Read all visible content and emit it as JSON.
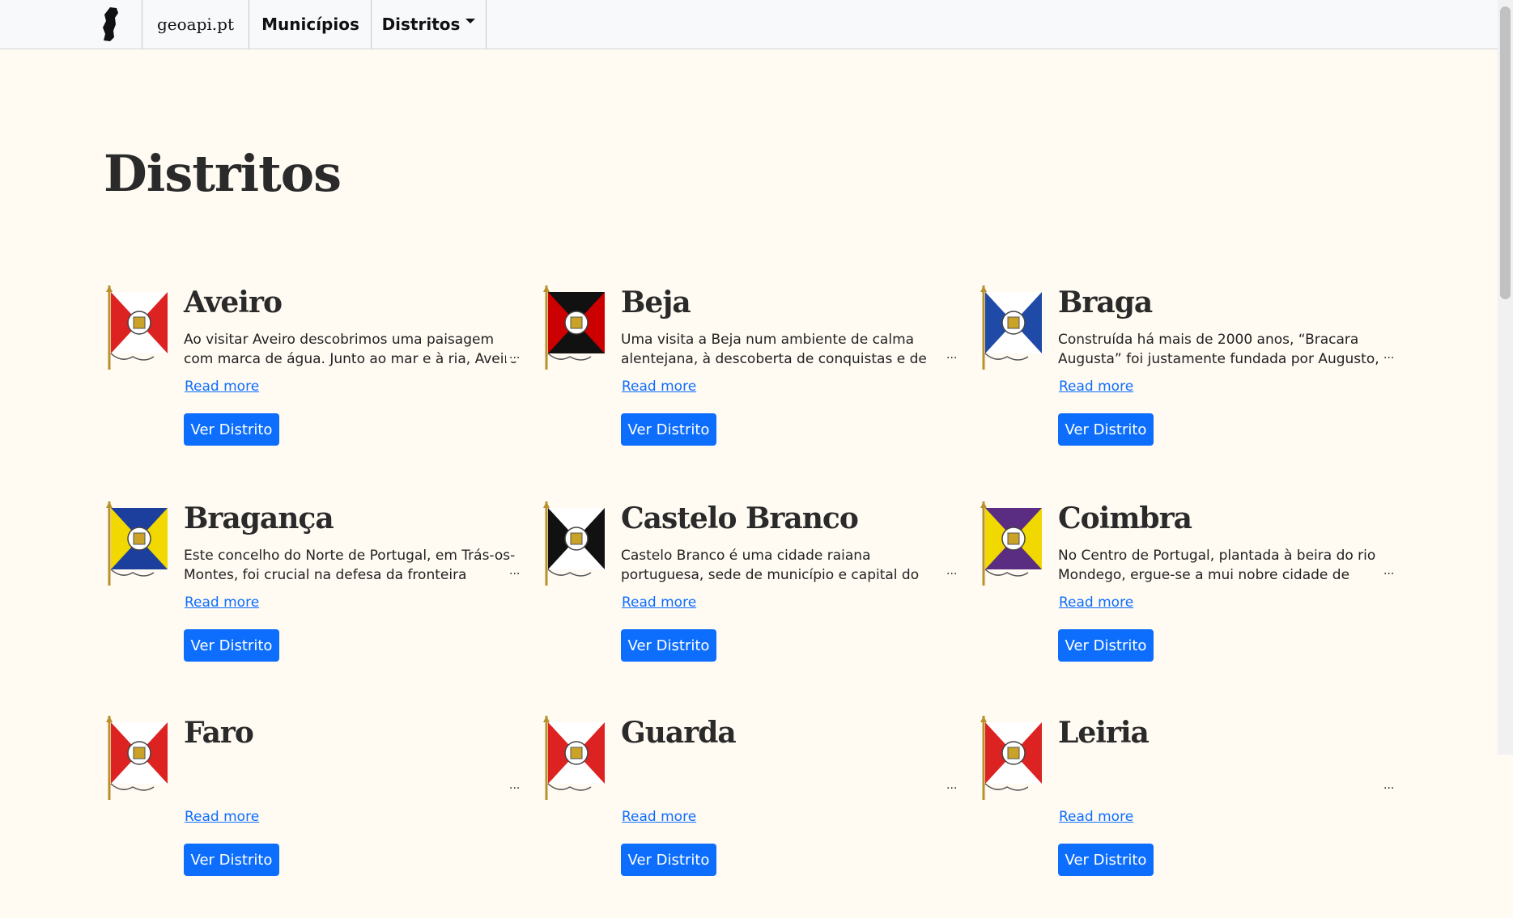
{
  "navbar": {
    "brand": "geoapi.pt",
    "municipios": "Municípios",
    "distritos": "Distritos"
  },
  "page": {
    "title": "Distritos"
  },
  "common": {
    "read_more": "Read more",
    "ver_distrito": "Ver Distrito",
    "ellipsis": "..."
  },
  "colors": {
    "accent": "#0d6efd",
    "background": "#fffaf2"
  },
  "districts": [
    {
      "name": "Aveiro",
      "desc": "Ao visitar Aveiro descobrimos uma paisagem com marca de água. Junto ao mar e à ria, Aveiro é",
      "flag": [
        "#d22",
        "#fff"
      ]
    },
    {
      "name": "Beja",
      "desc": "Uma visita a Beja num ambiente de calma alentejana, à descoberta de conquistas e de",
      "flag": [
        "#c00",
        "#111"
      ]
    },
    {
      "name": "Braga",
      "desc": "Construída há mais de 2000 anos, “Bracara Augusta” foi justamente fundada por Augusto,",
      "flag": [
        "#1f4aa8",
        "#fff"
      ]
    },
    {
      "name": "Bragança",
      "desc": "Este concelho do Norte de Portugal, em Trás-os-Montes, foi crucial na defesa da fronteira",
      "flag": [
        "#f0d800",
        "#1c3f9e"
      ]
    },
    {
      "name": "Castelo Branco",
      "desc": "Castelo Branco é uma cidade raiana portuguesa, sede de município e capital do distrito",
      "flag": [
        "#111",
        "#fff"
      ]
    },
    {
      "name": "Coimbra",
      "desc": "No Centro de Portugal, plantada à beira do rio Mondego, ergue-se a mui nobre cidade de",
      "flag": [
        "#f0d800",
        "#5b2d82"
      ]
    },
    {
      "name": "Faro",
      "desc": "",
      "flag": [
        "#d22",
        "#fff"
      ]
    },
    {
      "name": "Guarda",
      "desc": "",
      "flag": [
        "#d22",
        "#fff"
      ]
    },
    {
      "name": "Leiria",
      "desc": "",
      "flag": [
        "#d22",
        "#fff"
      ]
    }
  ]
}
